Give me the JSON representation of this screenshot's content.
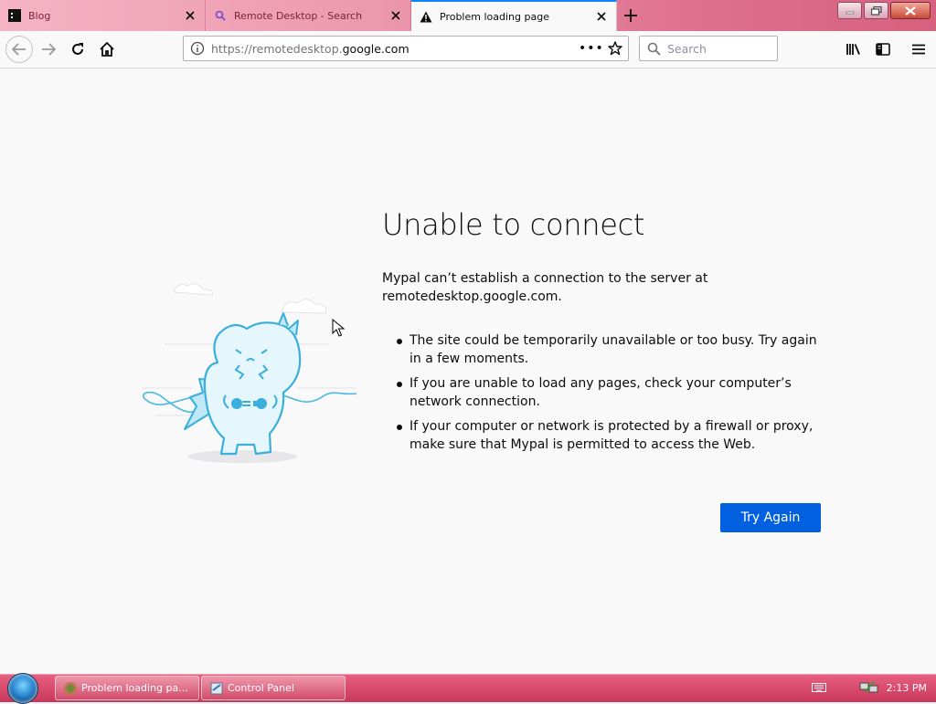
{
  "tabs": [
    {
      "title": "Blog",
      "favicon": "terminal-favicon-icon"
    },
    {
      "title": "Remote Desktop - Search",
      "favicon": "search-icon"
    },
    {
      "title": "Problem loading page",
      "favicon": "warning-icon",
      "active": true
    }
  ],
  "navbar": {
    "url_prefix": "https://remotedesktop.",
    "url_domain": "google.com",
    "page_actions": "•••",
    "search_placeholder": "Search"
  },
  "error": {
    "title": "Unable to connect",
    "description": "Mypal can’t establish a connection to the server at remotedesktop.google.com.",
    "bullets": [
      "The site could be temporarily unavailable or too busy. Try again in a few moments.",
      "If you are unable to load any pages, check your computer’s network connection.",
      "If your computer or network is protected by a firewall or proxy, make sure that Mypal is permitted to access the Web."
    ],
    "button": "Try Again"
  },
  "taskbar": {
    "items": [
      {
        "label": "Problem loading pa...",
        "icon": "browser-icon"
      },
      {
        "label": "Control Panel",
        "icon": "control-panel-icon"
      }
    ],
    "clock": "2:13 PM"
  },
  "colors": {
    "accent": "#0060df",
    "tabbar": "#de6f8f",
    "taskbar": "#c8385a"
  }
}
